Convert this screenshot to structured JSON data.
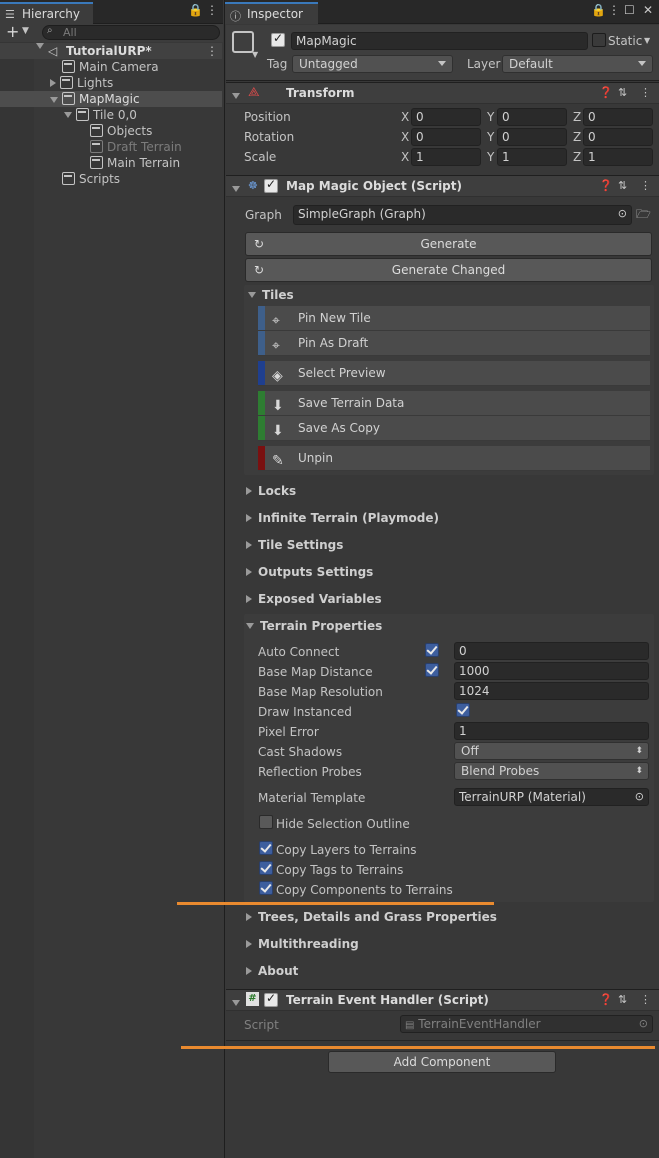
{
  "hierarchy": {
    "tab_label": "Hierarchy",
    "search_placeholder": "All",
    "items": [
      {
        "label": "TutorialURP*",
        "kind": "scene"
      },
      {
        "label": "Main Camera",
        "kind": "object"
      },
      {
        "label": "Lights",
        "kind": "object"
      },
      {
        "label": "MapMagic",
        "kind": "object"
      },
      {
        "label": "Tile 0,0",
        "kind": "object"
      },
      {
        "label": "Objects",
        "kind": "object"
      },
      {
        "label": "Draft Terrain",
        "kind": "object-disabled"
      },
      {
        "label": "Main Terrain",
        "kind": "object"
      },
      {
        "label": "Scripts",
        "kind": "object"
      }
    ]
  },
  "inspector": {
    "tab_label": "Inspector",
    "object_name": "MapMagic",
    "static_label": "Static",
    "tag_label": "Tag",
    "tag_value": "Untagged",
    "layer_label": "Layer",
    "layer_value": "Default",
    "transform": {
      "title": "Transform",
      "rows": [
        {
          "label": "Position",
          "x": "0",
          "y": "0",
          "z": "0"
        },
        {
          "label": "Rotation",
          "x": "0",
          "y": "0",
          "z": "0"
        },
        {
          "label": "Scale",
          "x": "1",
          "y": "1",
          "z": "1"
        }
      ],
      "axis_x": "X",
      "axis_y": "Y",
      "axis_z": "Z"
    },
    "mapmagic": {
      "title": "Map Magic Object (Script)",
      "graph_label": "Graph",
      "graph_value": "SimpleGraph (Graph)",
      "generate_label": "Generate",
      "generate_changed_label": "Generate Changed",
      "tiles_label": "Tiles",
      "tile_buttons": [
        "Pin New Tile",
        "Pin As Draft",
        "Select Preview",
        "Save Terrain Data",
        "Save As Copy",
        "Unpin"
      ],
      "sections": [
        "Locks",
        "Infinite Terrain (Playmode)",
        "Tile Settings",
        "Outputs Settings",
        "Exposed Variables"
      ],
      "terrain_properties": {
        "title": "Terrain Properties",
        "auto_connect_label": "Auto Connect",
        "auto_connect_value": "0",
        "base_map_distance_label": "Base Map Distance",
        "base_map_distance_value": "1000",
        "base_map_resolution_label": "Base Map Resolution",
        "base_map_resolution_value": "1024",
        "draw_instanced_label": "Draw Instanced",
        "pixel_error_label": "Pixel Error",
        "pixel_error_value": "1",
        "cast_shadows_label": "Cast Shadows",
        "cast_shadows_value": "Off",
        "reflection_probes_label": "Reflection Probes",
        "reflection_probes_value": "Blend Probes",
        "material_template_label": "Material Template",
        "material_template_value": "TerrainURP (Material)",
        "hide_selection_outline_label": "Hide Selection Outline",
        "copy_layers_label": "Copy Layers to Terrains",
        "copy_tags_label": "Copy Tags to Terrains",
        "copy_components_label": "Copy Components to Terrains"
      },
      "sections_after": [
        "Trees, Details and Grass Properties",
        "Multithreading",
        "About"
      ]
    },
    "event_handler": {
      "title": "Terrain Event Handler (Script)",
      "script_label": "Script",
      "script_value": "TerrainEventHandler"
    },
    "add_component_label": "Add Component"
  },
  "colors": {
    "accent_blue": "#3a79bb",
    "tile_blue": "#3e5f8a",
    "tile_darkblue": "#1f3f8f",
    "tile_green": "#2e7d32",
    "tile_red": "#7a1010",
    "annotation_orange": "#e98a2f"
  }
}
